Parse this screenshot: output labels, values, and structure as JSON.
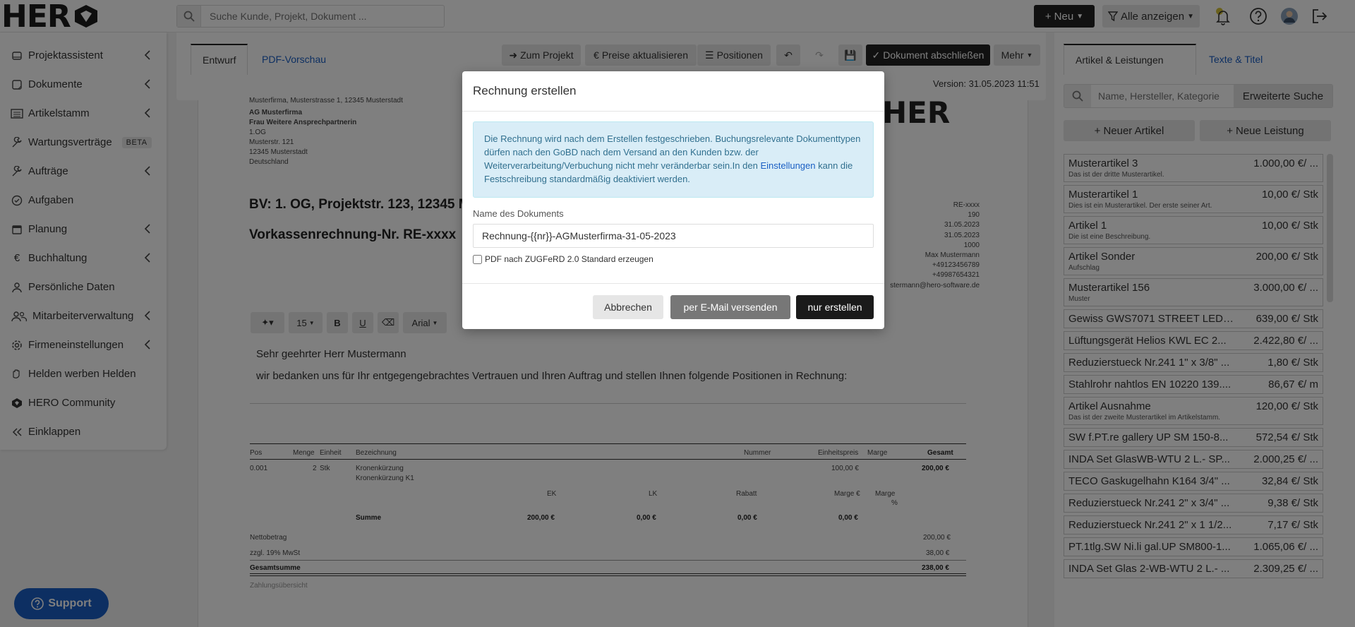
{
  "topbar": {
    "logo_text": "HER",
    "search_placeholder": "Suche Kunde, Projekt, Dokument ...",
    "new_button": "Neu",
    "filter_button": "Alle anzeigen"
  },
  "sidebar": {
    "items": [
      {
        "label": "Projektassistent",
        "icon": "clipboard-icon",
        "chevron": true
      },
      {
        "label": "Dokumente",
        "icon": "document-icon",
        "chevron": true
      },
      {
        "label": "Artikelstamm",
        "icon": "list-icon",
        "chevron": true
      },
      {
        "label": "Wartungsverträge",
        "icon": "wrench-icon",
        "chevron": false,
        "badge": "BETA"
      },
      {
        "label": "Aufträge",
        "icon": "wrench-icon",
        "chevron": true
      },
      {
        "label": "Aufgaben",
        "icon": "check-circle-icon",
        "chevron": false
      },
      {
        "label": "Planung",
        "icon": "calendar-icon",
        "chevron": true
      },
      {
        "label": "Buchhaltung",
        "icon": "euro-icon",
        "chevron": true
      },
      {
        "label": "Persönliche Daten",
        "icon": "user-icon",
        "chevron": false
      },
      {
        "label": "Mitarbeiterverwaltung",
        "icon": "users-icon",
        "chevron": true
      },
      {
        "label": "Firmeneinstellungen",
        "icon": "gear-icon",
        "chevron": true
      },
      {
        "label": "Helden werben Helden",
        "icon": "hand-icon",
        "chevron": false
      },
      {
        "label": "HERO Community",
        "icon": "hero-logo-icon",
        "chevron": false
      },
      {
        "label": "Einklappen",
        "icon": "double-chevron-left-icon",
        "chevron": false
      }
    ]
  },
  "support_label": "Support",
  "editor": {
    "tab_draft": "Entwurf",
    "tab_preview": "PDF-Vorschau",
    "btn_project": "Zum Projekt",
    "btn_prices": "Preise aktualisieren",
    "btn_positions": "Positionen",
    "btn_finish": "Dokument abschließen",
    "btn_more": "Mehr",
    "version": "Version: 31.05.2023 11:51"
  },
  "doc": {
    "sender_line": "Musterfirma, Musterstrasse 1, 12345 Musterstadt",
    "address": [
      "AG Musterfirma",
      "Frau Weitere Ansprechpartnerin",
      "1.OG",
      "Musterstr. 121",
      "12345 Musterstadt",
      "Deutschland"
    ],
    "heading1": "BV: 1. OG, Projektstr. 123, 12345 M",
    "heading2": "Vorkassenrechnung-Nr. RE-xxxx",
    "logo": "HER",
    "right_info": [
      "RE-xxxx",
      "190",
      "31.05.2023",
      "31.05.2023",
      "1000",
      "Max Mustermann",
      "+49123456789",
      "+49987654321",
      "stermann@hero-software.de"
    ],
    "font_size": "15",
    "font_name": "Arial",
    "greeting": "Sehr geehrter Herr Mustermann",
    "intro": "wir bedanken uns für Ihr entgegengebrachtes Vertrauen und Ihren Auftrag und stellen Ihnen folgende Positionen in Rechnung:",
    "table": {
      "headers": {
        "pos": "Pos",
        "menge": "Menge",
        "einheit": "Einheit",
        "bezeichnung": "Bezeichnung",
        "nummer": "Nummer",
        "einheitspreis": "Einheitspreis",
        "marge": "Marge",
        "gesamt": "Gesamt"
      },
      "row": {
        "pos": "0.001",
        "menge": "2",
        "einheit": "Stk",
        "name1": "Kronenkürzung",
        "name2": "Kronenkürzung K1",
        "einheitspreis": "100,00 €",
        "gesamt": "200,00 €"
      },
      "sub_headers": {
        "ek": "EK",
        "lk": "LK",
        "rabatt": "Rabatt",
        "marge_eur": "Marge €",
        "marge_pct": "Marge",
        "pct": "%"
      },
      "summe": {
        "label": "Summe",
        "ek": "200,00 €",
        "lk": "0,00 €",
        "rabatt": "0,00 €",
        "marge": "0,00 €"
      },
      "netto_label": "Nettobetrag",
      "netto": "200,00 €",
      "mwst_label": "zzgl. 19% MwSt",
      "mwst": "38,00 €",
      "total_label": "Gesamtsumme",
      "total": "238,00 €",
      "payment_label": "Zahlungsübersicht"
    }
  },
  "right_panel": {
    "tab_articles": "Artikel & Leistungen",
    "tab_texts": "Texte & Titel",
    "search_placeholder": "Name, Hersteller, Kategorie",
    "advanced_search": "Erweiterte Suche",
    "new_article": "Neuer Artikel",
    "new_service": "Neue Leistung",
    "articles": [
      {
        "name": "Musterartikel 3",
        "price": "1.000,00 €/ ...",
        "desc": "Das ist der dritte Musterartikel."
      },
      {
        "name": "Musterartikel 1",
        "price": "10,00 €/ Stk",
        "desc": "Dies ist ein Musterartikel. Der erste seiner Art."
      },
      {
        "name": "Artikel 1",
        "price": "10,00 €/ Stk",
        "desc": "Die ist eine Beschreibung."
      },
      {
        "name": "Artikel Sonder",
        "price": "200,00 €/ Stk",
        "desc": "Aufschlag"
      },
      {
        "name": "Musterartikel 156",
        "price": "3.000,00 €/ ...",
        "desc": "Muster"
      },
      {
        "name": "Gewiss GWS7071 STREET LED 2...",
        "price": "639,00 €/ Stk",
        "desc": ""
      },
      {
        "name": "Lüftungsgerät Helios KWL EC 2...",
        "price": "2.422,80 €/ ...",
        "desc": ""
      },
      {
        "name": "Reduzierstueck Nr.241 1\" x 3/8\" ...",
        "price": "1,80 €/ Stk",
        "desc": ""
      },
      {
        "name": "Stahlrohr nahtlos EN 10220 139....",
        "price": "86,67 €/ m",
        "desc": ""
      },
      {
        "name": "Artikel Ausnahme",
        "price": "120,00 €/ Stk",
        "desc": "Das ist der zweite Musterartikel im Artikelstamm."
      },
      {
        "name": "SW f.PT.re gallery UP SM 150-8...",
        "price": "572,54 €/ Stk",
        "desc": ""
      },
      {
        "name": "INDA Set GlasWB-WTU 2 L.- SP...",
        "price": "2.000,25 €/ ...",
        "desc": ""
      },
      {
        "name": "TECO Gaskugelhahn K164 3/4\" ...",
        "price": "32,84 €/ Stk",
        "desc": ""
      },
      {
        "name": "Reduzierstueck Nr.241 2\" x 3/4\" ...",
        "price": "9,38 €/ Stk",
        "desc": ""
      },
      {
        "name": "Reduzierstueck Nr.241 2\" x 1 1/2...",
        "price": "7,17 €/ Stk",
        "desc": ""
      },
      {
        "name": "PT.1tlg.SW Ni.li gal.UP SM800-1...",
        "price": "1.065,06 €/ ...",
        "desc": ""
      },
      {
        "name": "INDA Set Glas 2-WB-WTU 2 L.- ...",
        "price": "2.309,25 €/ ...",
        "desc": ""
      }
    ]
  },
  "modal": {
    "title": "Rechnung erstellen",
    "info_part1": "Die Rechnung wird nach dem Erstellen festgeschrieben. Buchungsrelevante Dokumenttypen dürfen nach den GoBD nach dem Versand an den Kunden bzw. der Weiterverarbeitung/Verbuchung nicht mehr veränderbar sein.In den ",
    "info_link": "Einstellungen",
    "info_part2": " kann die Festschreibung standardmäßig deaktiviert werden.",
    "name_label": "Name des Dokuments",
    "name_value": "Rechnung-{{nr}}-AGMusterfirma-31-05-2023",
    "checkbox_label": "PDF nach ZUGFeRD 2.0 Standard erzeugen",
    "btn_cancel": "Abbrechen",
    "btn_email": "per E-Mail versenden",
    "btn_create": "nur erstellen"
  }
}
